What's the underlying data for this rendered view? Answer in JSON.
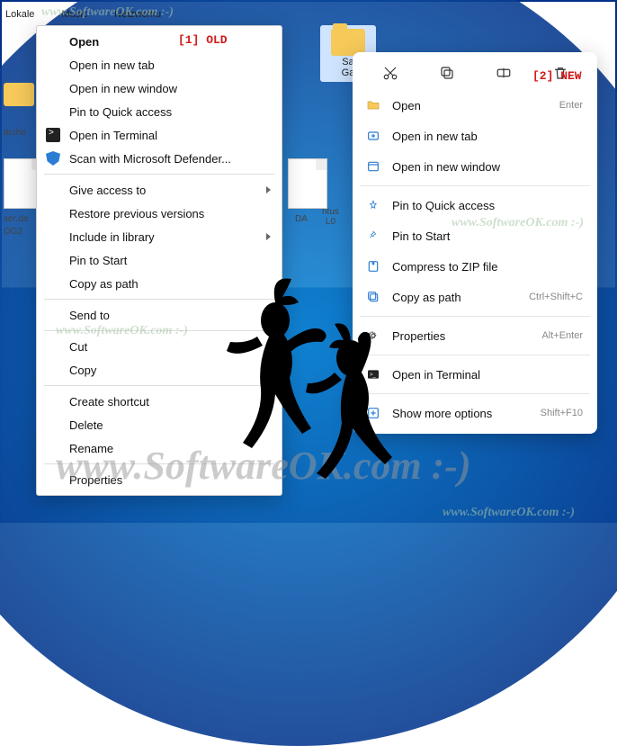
{
  "top_folders": [
    "Lokale",
    "Music",
    "Netzwerku"
  ],
  "right_folder_label": "Sa\nGa",
  "left_frag_1": "arche",
  "left_frag_2": "ser.da",
  "left_frag_3": "OG2",
  "mid_frag_1": "DA",
  "mid_frag_2": "ntus\nL0",
  "old_menu": {
    "open": "Open",
    "open_new_tab": "Open in new tab",
    "open_new_window": "Open in new window",
    "pin_quick": "Pin to Quick access",
    "open_terminal": "Open in Terminal",
    "scan_defender": "Scan with Microsoft Defender...",
    "give_access": "Give access to",
    "restore": "Restore previous versions",
    "include_lib": "Include in library",
    "pin_start": "Pin to Start",
    "copy_path": "Copy as path",
    "send_to": "Send to",
    "cut": "Cut",
    "copy": "Copy",
    "create_shortcut": "Create shortcut",
    "delete": "Delete",
    "rename": "Rename",
    "properties": "Properties"
  },
  "new_menu": {
    "open": "Open",
    "open_sc": "Enter",
    "open_new_tab": "Open in new tab",
    "open_new_window": "Open in new window",
    "pin_quick": "Pin to Quick access",
    "pin_start": "Pin to Start",
    "compress": "Compress to ZIP file",
    "copy_path": "Copy as path",
    "copy_path_sc": "Ctrl+Shift+C",
    "properties": "Properties",
    "properties_sc": "Alt+Enter",
    "open_terminal": "Open in Terminal",
    "show_more": "Show more options",
    "show_more_sc": "Shift+F10"
  },
  "badges": {
    "old": "[1]  OLD",
    "new": "[2] NEW"
  },
  "watermark": "www.SoftwareOK.com :-)"
}
